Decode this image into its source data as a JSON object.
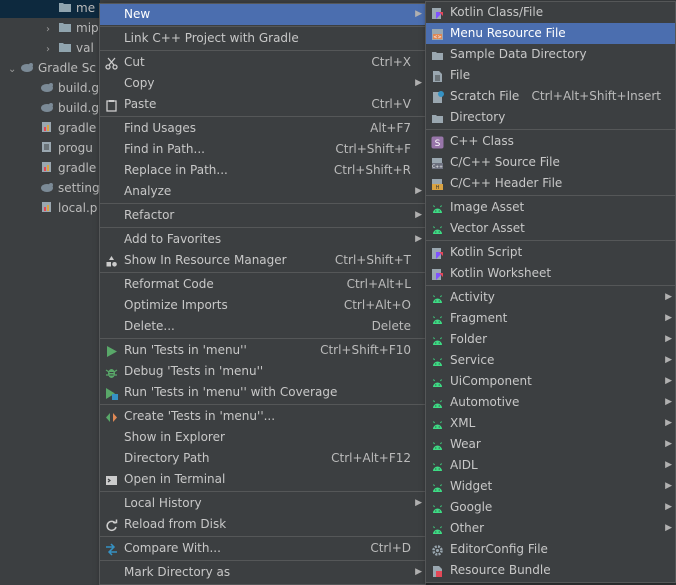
{
  "tree": {
    "rows": [
      {
        "label": "me",
        "type": "folder",
        "indent": 64,
        "selected": true
      },
      {
        "label": "mip",
        "type": "folder",
        "indent": 64,
        "arrow": "›"
      },
      {
        "label": "val",
        "type": "folder",
        "indent": 64,
        "arrow": "›"
      },
      {
        "label": "Gradle Sc",
        "type": "gradle",
        "indent": 26,
        "arrow": "⌄"
      },
      {
        "label": "build.g",
        "type": "gradle",
        "indent": 46
      },
      {
        "label": "build.g",
        "type": "gradle",
        "indent": 46
      },
      {
        "label": "gradle",
        "type": "prop",
        "indent": 46
      },
      {
        "label": "progu",
        "type": "file",
        "indent": 46
      },
      {
        "label": "gradle",
        "type": "prop",
        "indent": 46
      },
      {
        "label": "setting",
        "type": "gradle",
        "indent": 46
      },
      {
        "label": "local.p",
        "type": "prop",
        "indent": 46
      }
    ]
  },
  "context_menu": {
    "items": [
      {
        "label": "New",
        "sub": true,
        "hl": true
      },
      {
        "sep": true
      },
      {
        "label": "Link C++ Project with Gradle"
      },
      {
        "sep": true
      },
      {
        "label": "Cut",
        "sc": "Ctrl+X",
        "icon": "scissors"
      },
      {
        "label": "Copy",
        "sub": true
      },
      {
        "label": "Paste",
        "sc": "Ctrl+V",
        "icon": "clipboard"
      },
      {
        "sep": true
      },
      {
        "label": "Find Usages",
        "sc": "Alt+F7"
      },
      {
        "label": "Find in Path...",
        "sc": "Ctrl+Shift+F"
      },
      {
        "label": "Replace in Path...",
        "sc": "Ctrl+Shift+R"
      },
      {
        "label": "Analyze",
        "sub": true
      },
      {
        "sep": true
      },
      {
        "label": "Refactor",
        "sub": true
      },
      {
        "sep": true
      },
      {
        "label": "Add to Favorites",
        "sub": true
      },
      {
        "label": "Show In Resource Manager",
        "sc": "Ctrl+Shift+T",
        "icon": "resource"
      },
      {
        "sep": true
      },
      {
        "label": "Reformat Code",
        "sc": "Ctrl+Alt+L"
      },
      {
        "label": "Optimize Imports",
        "sc": "Ctrl+Alt+O"
      },
      {
        "label": "Delete...",
        "sc": "Delete"
      },
      {
        "sep": true
      },
      {
        "label": "Run 'Tests in 'menu''",
        "sc": "Ctrl+Shift+F10",
        "icon": "run"
      },
      {
        "label": "Debug 'Tests in 'menu''",
        "icon": "debug"
      },
      {
        "label": "Run 'Tests in 'menu'' with Coverage",
        "icon": "coverage"
      },
      {
        "sep": true
      },
      {
        "label": "Create 'Tests in 'menu''...",
        "icon": "create"
      },
      {
        "label": "Show in Explorer"
      },
      {
        "label": "Directory Path",
        "sc": "Ctrl+Alt+F12"
      },
      {
        "label": "Open in Terminal",
        "icon": "terminal"
      },
      {
        "sep": true
      },
      {
        "label": "Local History",
        "sub": true
      },
      {
        "label": "Reload from Disk",
        "icon": "reload"
      },
      {
        "sep": true
      },
      {
        "label": "Compare With...",
        "sc": "Ctrl+D",
        "icon": "compare"
      },
      {
        "sep": true
      },
      {
        "label": "Mark Directory as",
        "sub": true
      }
    ]
  },
  "submenu": {
    "items": [
      {
        "label": "Kotlin Class/File",
        "icon": "kotlin"
      },
      {
        "label": "Menu Resource File",
        "icon": "menures",
        "hl": true
      },
      {
        "label": "Sample Data Directory",
        "icon": "folder"
      },
      {
        "label": "File",
        "icon": "file"
      },
      {
        "label": "Scratch File",
        "sc": "Ctrl+Alt+Shift+Insert",
        "icon": "scratch"
      },
      {
        "label": "Directory",
        "icon": "folder"
      },
      {
        "sep": true
      },
      {
        "label": "C++ Class",
        "icon": "cppclass"
      },
      {
        "label": "C/C++ Source File",
        "icon": "cppsrc"
      },
      {
        "label": "C/C++ Header File",
        "icon": "cpphdr"
      },
      {
        "sep": true
      },
      {
        "label": "Image Asset",
        "icon": "android"
      },
      {
        "label": "Vector Asset",
        "icon": "android"
      },
      {
        "sep": true
      },
      {
        "label": "Kotlin Script",
        "icon": "kscript"
      },
      {
        "label": "Kotlin Worksheet",
        "icon": "kscript"
      },
      {
        "sep": true
      },
      {
        "label": "Activity",
        "icon": "android",
        "sub": true
      },
      {
        "label": "Fragment",
        "icon": "android",
        "sub": true
      },
      {
        "label": "Folder",
        "icon": "android",
        "sub": true
      },
      {
        "label": "Service",
        "icon": "android",
        "sub": true
      },
      {
        "label": "UiComponent",
        "icon": "android",
        "sub": true
      },
      {
        "label": "Automotive",
        "icon": "android",
        "sub": true
      },
      {
        "label": "XML",
        "icon": "android",
        "sub": true
      },
      {
        "label": "Wear",
        "icon": "android",
        "sub": true
      },
      {
        "label": "AIDL",
        "icon": "android",
        "sub": true
      },
      {
        "label": "Widget",
        "icon": "android",
        "sub": true
      },
      {
        "label": "Google",
        "icon": "android",
        "sub": true
      },
      {
        "label": "Other",
        "icon": "android",
        "sub": true
      },
      {
        "label": "EditorConfig File",
        "icon": "gear"
      },
      {
        "label": "Resource Bundle",
        "icon": "bundle"
      }
    ]
  },
  "colors": {
    "highlight": "#4b6eaf",
    "menu_bg": "#3c3f41",
    "android": "#3ddc84"
  }
}
